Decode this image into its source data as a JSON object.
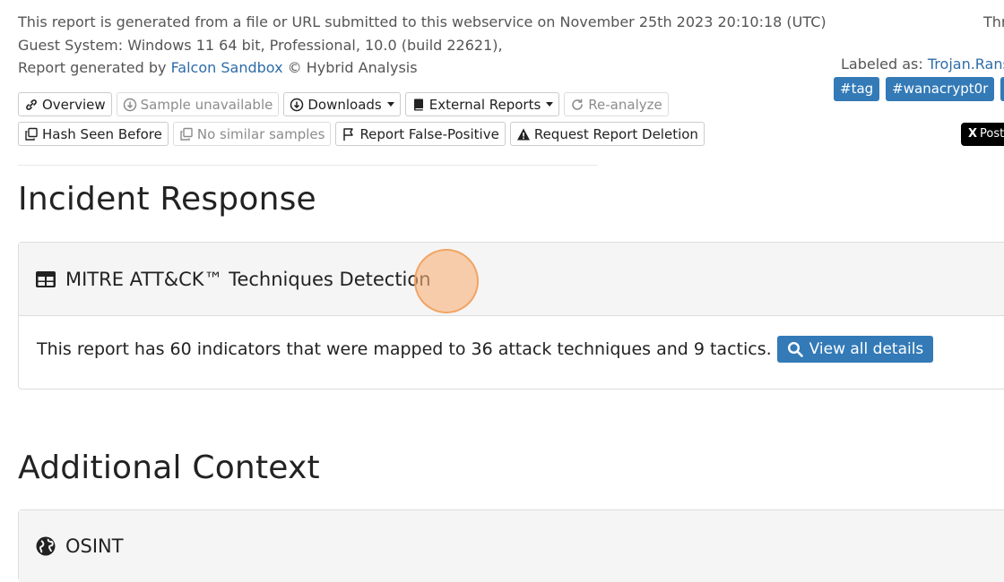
{
  "meta": {
    "line1": "This report is generated from a file or URL submitted to this webservice on November 25th 2023 20:10:18 (UTC)",
    "line2": "Guest System: Windows 11 64 bit, Professional, 10.0 (build 22621),",
    "line3_prefix": "Report generated by ",
    "line3_link": "Falcon Sandbox",
    "line3_suffix": " © Hybrid Analysis"
  },
  "right": {
    "top_cut": "Thr",
    "labeled_prefix": "Labeled as: ",
    "labeled_value": "Trojan.Rans",
    "tags": [
      "#tag",
      "#wanacrypt0r",
      "#"
    ],
    "x_post": "Post"
  },
  "toolbar": {
    "row1": [
      {
        "label": "Overview",
        "icon": "link-icon",
        "disabled": false
      },
      {
        "label": "Sample unavailable",
        "icon": "download-circle-icon",
        "disabled": true
      },
      {
        "label": "Downloads",
        "icon": "download-circle-icon",
        "disabled": false,
        "dropdown": true
      },
      {
        "label": "External Reports",
        "icon": "book-icon",
        "disabled": false,
        "dropdown": true
      },
      {
        "label": "Re-analyze",
        "icon": "refresh-icon",
        "disabled": true
      }
    ],
    "row2": [
      {
        "label": "Hash Seen Before",
        "icon": "copy-icon",
        "disabled": false
      },
      {
        "label": "No similar samples",
        "icon": "copy-icon",
        "disabled": true
      },
      {
        "label": "Report False-Positive",
        "icon": "flag-icon",
        "disabled": false
      },
      {
        "label": "Request Report Deletion",
        "icon": "warning-icon",
        "disabled": false
      }
    ]
  },
  "sections": {
    "incident_response": "Incident Response",
    "additional_context": "Additional Context"
  },
  "mitre": {
    "title": "MITRE ATT&CK™ Techniques Detection",
    "body": "This report has 60 indicators that were mapped to 36 attack techniques and 9 tactics.",
    "button": "View all details"
  },
  "osint": {
    "title": "OSINT"
  }
}
